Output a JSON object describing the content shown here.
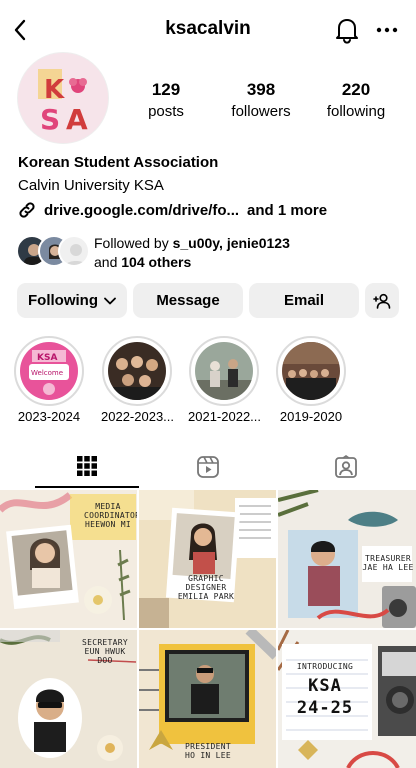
{
  "header": {
    "username": "ksacalvin"
  },
  "profile": {
    "avatar_text": "KSA",
    "stats": {
      "posts": {
        "value": "129",
        "label": "posts"
      },
      "followers": {
        "value": "398",
        "label": "followers"
      },
      "following": {
        "value": "220",
        "label": "following"
      }
    },
    "name": "Korean Student Association",
    "subtitle": "Calvin University KSA",
    "link": "drive.google.com/drive/fo...",
    "link_more": "and 1 more"
  },
  "followed_by": {
    "prefix": "Followed by ",
    "names": "s_u00y, jenie0123",
    "and": "and ",
    "others": "104 others"
  },
  "actions": {
    "following": "Following",
    "message": "Message",
    "email": "Email"
  },
  "highlights": [
    {
      "label": "2023-2024"
    },
    {
      "label": "2022-2023..."
    },
    {
      "label": "2021-2022..."
    },
    {
      "label": "2019-2020"
    }
  ],
  "posts": [
    {
      "text": "MEDIA COORDINATOR HEEWON MI"
    },
    {
      "text": "GRAPHIC DESIGNER EMILIA PARK"
    },
    {
      "text": "TREASURER JAE HA LEE"
    },
    {
      "text": "SECRETARY EUN HWUK DOO"
    },
    {
      "text": "PRESIDENT HO IN LEE"
    },
    {
      "text": "INTRODUCING",
      "title": "KSA",
      "subtitle": "24-25"
    }
  ],
  "icons": {
    "back": "chevron-left-icon",
    "bell": "bell-icon",
    "more": "more-horizontal-icon",
    "link": "link-icon",
    "add_user": "add-user-icon",
    "grid": "grid-icon",
    "reels": "reels-icon",
    "tagged": "tagged-icon"
  },
  "colors": {
    "button_bg": "#efefef",
    "ring": "#dbdbdb",
    "ksa_pink": "#e0457b",
    "ksa_red": "#d13c3c"
  }
}
